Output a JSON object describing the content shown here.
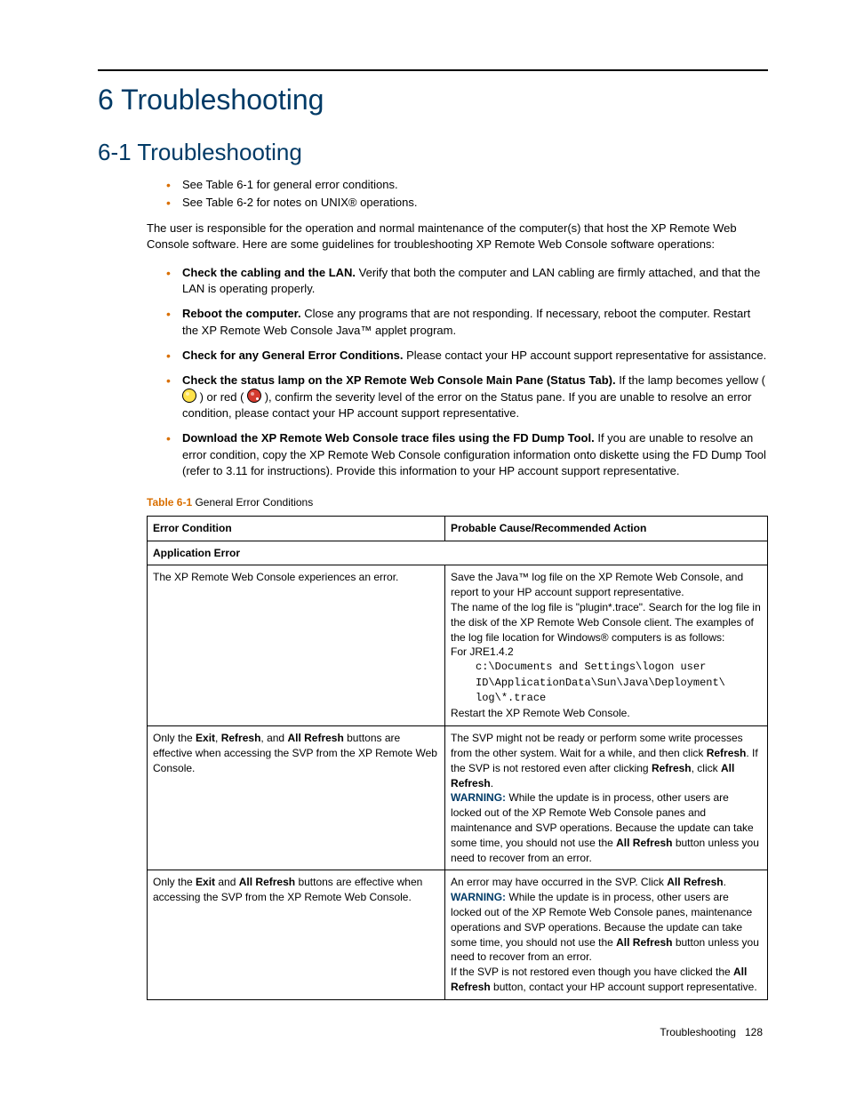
{
  "chapter_title": "6 Troubleshooting",
  "section_title": "6-1 Troubleshooting",
  "intro_bullets": [
    "See Table 6-1 for general error conditions.",
    "See Table 6-2 for notes on UNIX® operations."
  ],
  "intro_para": "The user is responsible for the operation and normal maintenance of the computer(s) that host the XP Remote Web Console software. Here are some guidelines for troubleshooting XP Remote Web Console software operations:",
  "troubleshoot_items": [
    {
      "bold": "Check the cabling and the LAN.",
      "rest": " Verify that both the computer and LAN cabling are firmly attached, and that the LAN is operating properly."
    },
    {
      "bold": "Reboot the computer.",
      "rest": " Close any programs that are not responding. If necessary, reboot the computer. Restart the XP Remote Web Console Java™ applet program."
    },
    {
      "bold": "Check for any General Error Conditions.",
      "rest": " Please contact your HP account support representative for assistance."
    }
  ],
  "status_lamp": {
    "bold": "Check the status lamp on the XP Remote Web Console Main Pane (Status Tab).",
    "pre": " If the lamp becomes yellow ( ",
    "mid": " ) or red ( ",
    "post": " ), confirm the severity level of the error on the Status pane. If you are unable to resolve an error condition, please contact your HP account support representative."
  },
  "download_item": {
    "bold": "Download the XP Remote Web Console trace files using the FD Dump Tool.",
    "rest": " If you are unable to resolve an error condition, copy the XP Remote Web Console configuration information onto diskette using the FD Dump Tool (refer to 3.11 for instructions). Provide this information to your HP account support representative."
  },
  "table": {
    "label_prefix": "Table 6-1",
    "label_title": "  General Error Conditions",
    "col1": "Error Condition",
    "col2": "Probable Cause/Recommended Action",
    "group": "Application Error",
    "rows": [
      {
        "condition_html": "The XP Remote Web Console experiences an error.",
        "action": {
          "p1": "Save the Java™ log file on the XP Remote Web Console, and report to your HP account support representative.",
          "p2": "The name of the log file is \"plugin*.trace\". Search for the log file in the disk of the XP Remote Web Console client. The examples of the log file location for Windows® computers is as follows:",
          "p3": "For JRE1.4.2",
          "code1": "c:\\Documents and Settings\\logon user",
          "code2": "ID\\ApplicationData\\Sun\\Java\\Deployment\\",
          "code3": "log\\*.trace",
          "p4": "Restart the XP Remote Web Console."
        }
      },
      {
        "condition": {
          "t1": "Only the ",
          "b1": "Exit",
          "t2": ", ",
          "b2": "Refresh",
          "t3": ", and ",
          "b3": "All Refresh",
          "t4": " buttons are effective when accessing the SVP from the XP Remote Web Console."
        },
        "action": {
          "t1": "The SVP might not be ready or perform some write processes from the other system. Wait for a while, and then click ",
          "b1": "Refresh",
          "t2": ". If the SVP is not restored even after clicking ",
          "b2": "Refresh",
          "t3": ", click ",
          "b3": "All Refresh",
          "t4": ".",
          "warn": "WARNING:",
          "t5": "  While the update is in process, other users are locked out of the XP Remote Web Console panes and maintenance and SVP operations. Because the update can take some time, you should not use the ",
          "b4": "All Refresh",
          "t6": " button unless you need to recover from an error."
        }
      },
      {
        "condition": {
          "t1": "Only the ",
          "b1": "Exit",
          "t2": " and ",
          "b2": "All Refresh",
          "t3": " buttons are effective when accessing the SVP from the XP Remote Web Console."
        },
        "action": {
          "t1": "An error may have occurred in the SVP. Click ",
          "b1": "All Refresh",
          "t2": ".",
          "warn": "WARNING:",
          "t3": "  While the update is in process, other users are locked out of the XP Remote Web Console panes, maintenance operations and SVP operations. Because the update can take some time, you should not use the ",
          "b2": "All Refresh",
          "t4": " button unless you need to recover from an error.",
          "t5": "If the SVP is not restored even though you have clicked the ",
          "b3": "All Refresh",
          "t6": " button, contact your HP account support representative."
        }
      }
    ]
  },
  "footer": {
    "label": "Troubleshooting",
    "page": "128"
  }
}
